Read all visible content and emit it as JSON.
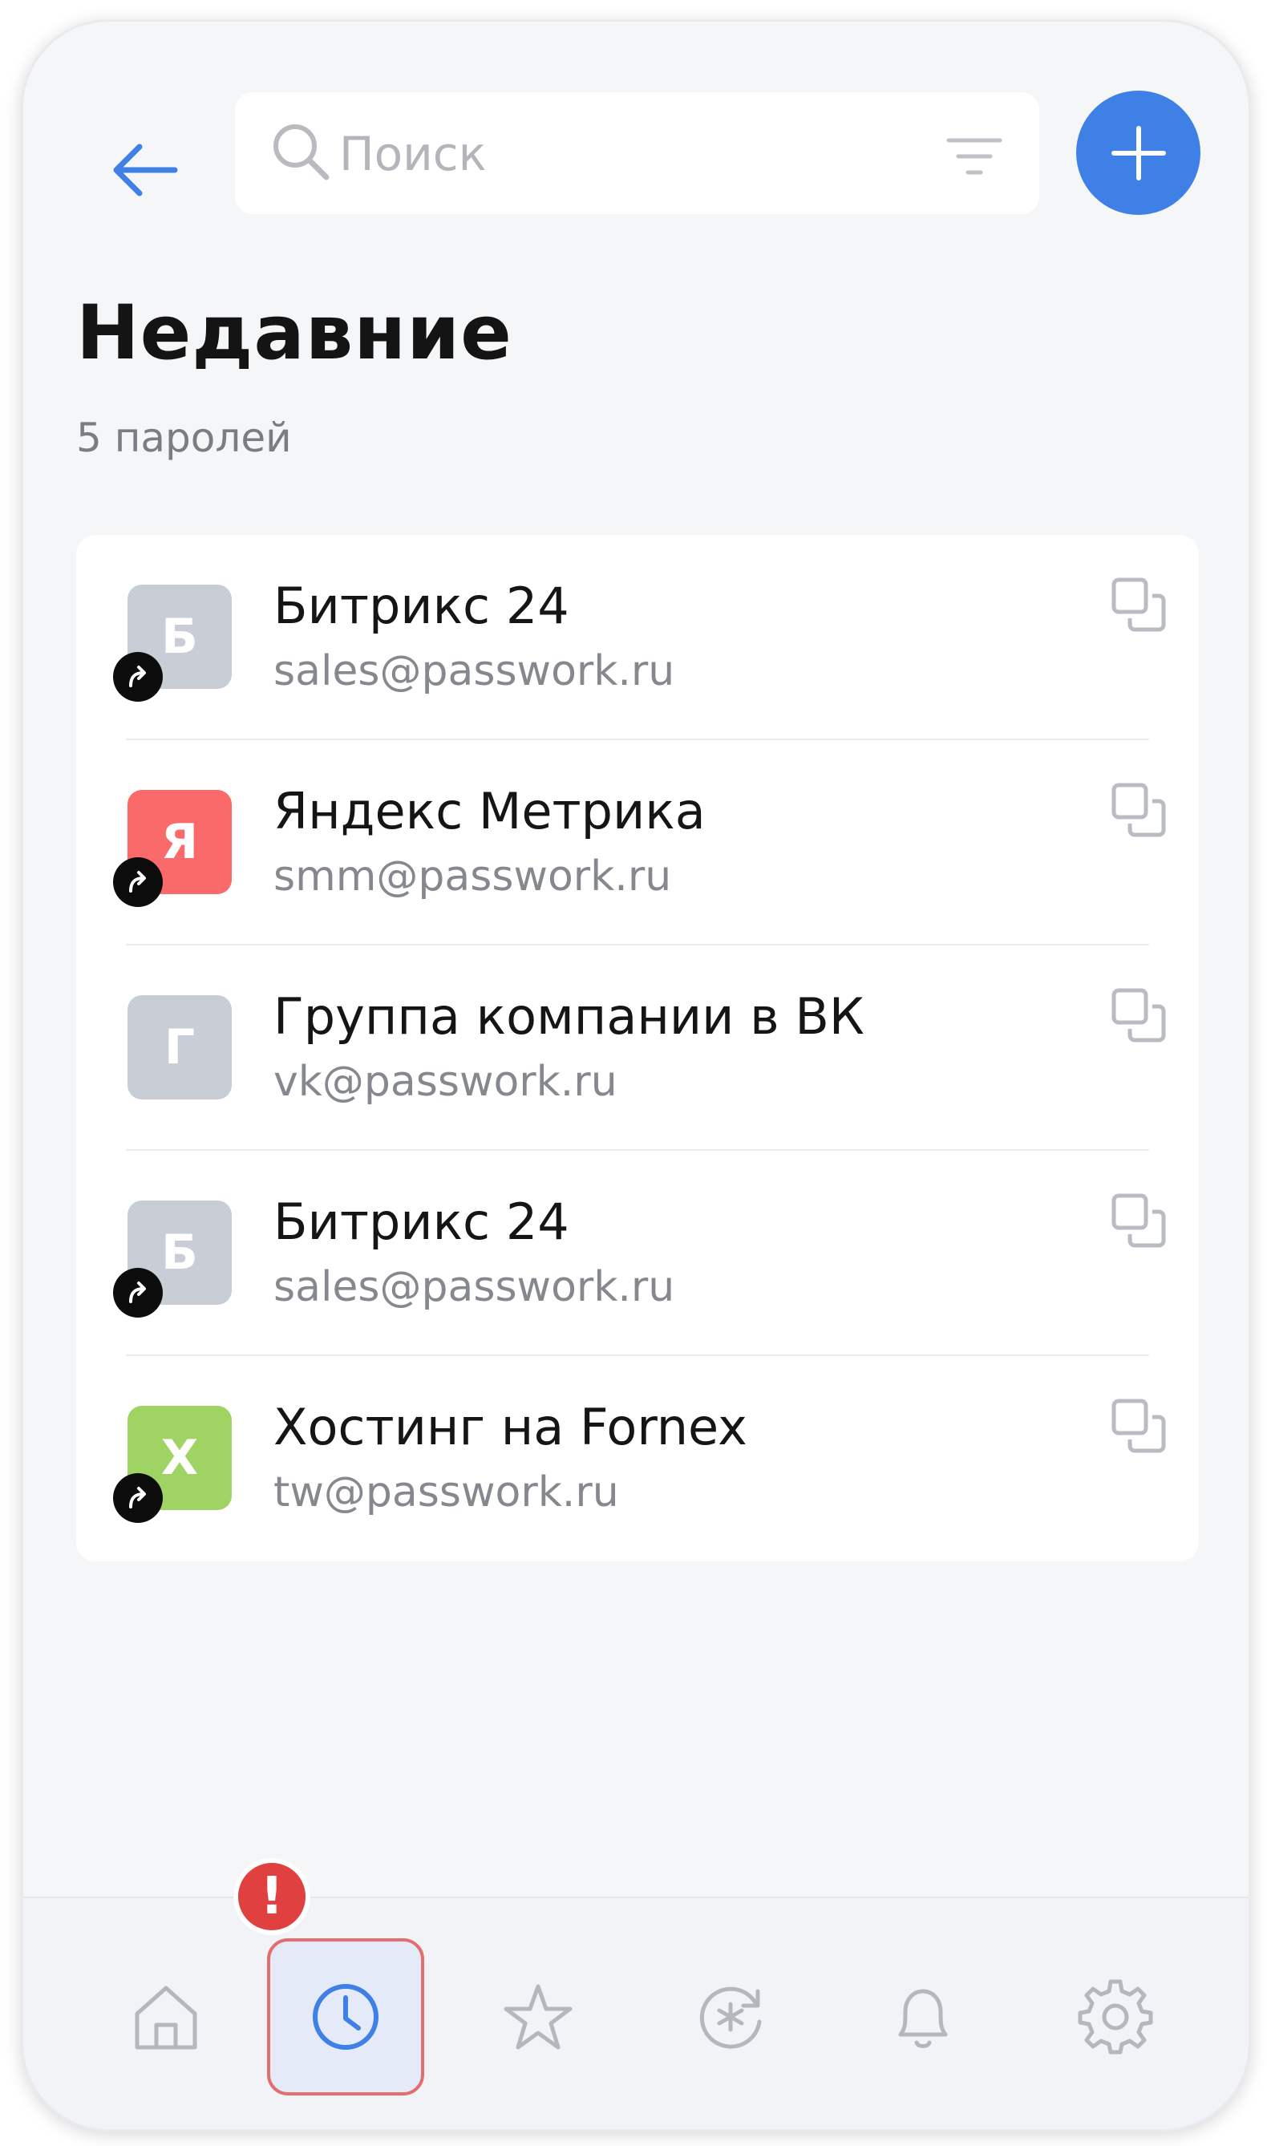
{
  "header": {
    "search_placeholder": "Поиск"
  },
  "page": {
    "title": "Недавние",
    "subtitle": "5 паролей"
  },
  "items": [
    {
      "initial": "Б",
      "name": "Битрикс 24",
      "login": "sales@passwork.ru",
      "color": "#c9ced6",
      "shared": true
    },
    {
      "initial": "Я",
      "name": "Яндекс Метрика",
      "login": "smm@passwork.ru",
      "color": "#fb6a6a",
      "shared": true
    },
    {
      "initial": "Г",
      "name": "Группа компании в ВК",
      "login": "vk@passwork.ru",
      "color": "#c9ced6",
      "shared": false
    },
    {
      "initial": "Б",
      "name": "Битрикс 24",
      "login": "sales@passwork.ru",
      "color": "#c9ced6",
      "shared": true
    },
    {
      "initial": "Х",
      "name": "Хостинг на Fornex",
      "login": "tw@passwork.ru",
      "color": "#9fd364",
      "shared": true
    }
  ],
  "bottom_nav": {
    "items": [
      {
        "icon": "home-icon",
        "active": false
      },
      {
        "icon": "clock-icon",
        "active": true
      },
      {
        "icon": "star-icon",
        "active": false
      },
      {
        "icon": "password-refresh-icon",
        "active": false
      },
      {
        "icon": "bell-icon",
        "active": false
      },
      {
        "icon": "gear-icon",
        "active": false
      }
    ],
    "alert_badge": "!"
  },
  "colors": {
    "accent": "#3f80e6",
    "background": "#f5f6f8",
    "alert": "#e04040"
  }
}
